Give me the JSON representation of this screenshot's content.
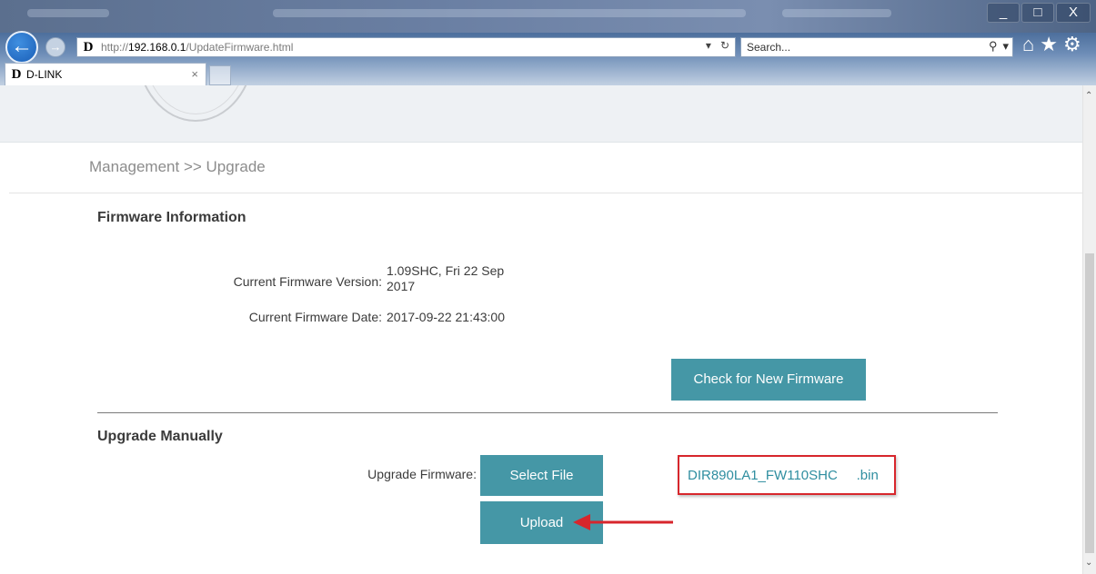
{
  "browser": {
    "address": {
      "url_prefix": "http://",
      "url_host": "192.168.0.1",
      "url_path": "/UpdateFirmware.html"
    },
    "search": {
      "placeholder": "Search..."
    },
    "tab": {
      "title": "D-LINK"
    },
    "window_controls": {
      "minimize": "_",
      "maximize": "□",
      "close": "X"
    }
  },
  "page": {
    "breadcrumb": "Management >> Upgrade",
    "firmware_info": {
      "title": "Firmware Information",
      "version_label": "Current Firmware Version:",
      "version_value_line1": "1.09SHC, Fri 22 Sep",
      "version_value_line2": "2017",
      "date_label": "Current Firmware Date:",
      "date_value": "2017-09-22 21:43:00",
      "check_button": "Check for New Firmware"
    },
    "upgrade_manually": {
      "title": "Upgrade Manually",
      "firmware_label": "Upgrade Firmware:",
      "select_button": "Select File",
      "upload_button": "Upload",
      "selected_file": "DIR890LA1_FW110SHC     .bin"
    }
  },
  "colors": {
    "button_teal": "#4597a6",
    "highlight_red": "#d7262c",
    "file_text": "#2f8ea0"
  },
  "icons": [
    "back-arrow-icon",
    "forward-arrow-icon",
    "dlink-favicon-icon",
    "refresh-icon",
    "dropdown-icon",
    "search-icon",
    "home-icon",
    "star-icon",
    "gear-icon",
    "close-icon",
    "red-arrow-icon"
  ]
}
